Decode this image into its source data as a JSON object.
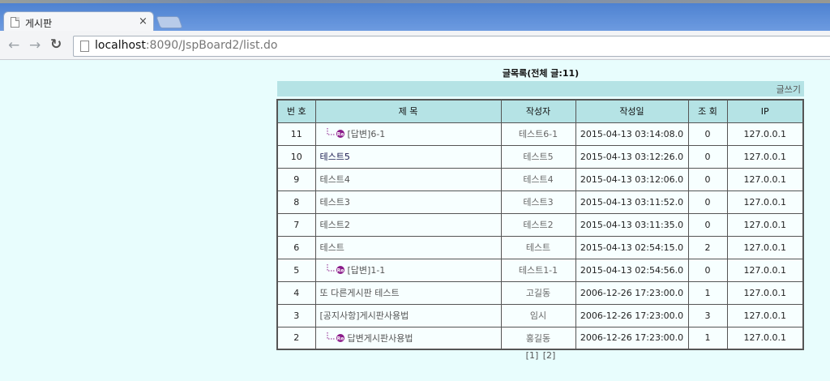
{
  "browser": {
    "tab_title": "게시판",
    "tab_close": "×",
    "url_host": "localhost",
    "url_rest": ":8090/JspBoard2/list.do"
  },
  "board": {
    "title": "글목록(전체 글:11)",
    "write_link": "글쓰기",
    "columns": [
      "번 호",
      "제 목",
      "작성자",
      "작성일",
      "조 회",
      "IP"
    ],
    "rows": [
      {
        "num": "11",
        "subject": "[답변]6-1",
        "writer": "테스트6-1",
        "date": "2015-04-13 03:14:08.0",
        "views": "0",
        "ip": "127.0.0.1",
        "reply": true
      },
      {
        "num": "10",
        "subject": "테스트5",
        "writer": "테스트5",
        "date": "2015-04-13 03:12:26.0",
        "views": "0",
        "ip": "127.0.0.1",
        "reply": false
      },
      {
        "num": "9",
        "subject": "테스트4",
        "writer": "테스트4",
        "date": "2015-04-13 03:12:06.0",
        "views": "0",
        "ip": "127.0.0.1",
        "reply": false
      },
      {
        "num": "8",
        "subject": "테스트3",
        "writer": "테스트3",
        "date": "2015-04-13 03:11:52.0",
        "views": "0",
        "ip": "127.0.0.1",
        "reply": false
      },
      {
        "num": "7",
        "subject": "테스트2",
        "writer": "테스트2",
        "date": "2015-04-13 03:11:35.0",
        "views": "0",
        "ip": "127.0.0.1",
        "reply": false
      },
      {
        "num": "6",
        "subject": "테스트",
        "writer": "테스트",
        "date": "2015-04-13 02:54:15.0",
        "views": "2",
        "ip": "127.0.0.1",
        "reply": false
      },
      {
        "num": "5",
        "subject": "[답변]1-1",
        "writer": "테스트1-1",
        "date": "2015-04-13 02:54:56.0",
        "views": "0",
        "ip": "127.0.0.1",
        "reply": true
      },
      {
        "num": "4",
        "subject": "또 다른게시판 테스트",
        "writer": "고길동",
        "date": "2006-12-26 17:23:00.0",
        "views": "1",
        "ip": "127.0.0.1",
        "reply": false
      },
      {
        "num": "3",
        "subject": "[공지사항]게시판사용법",
        "writer": "임시",
        "date": "2006-12-26 17:23:00.0",
        "views": "3",
        "ip": "127.0.0.1",
        "reply": false
      },
      {
        "num": "2",
        "subject": "답변게시판사용법",
        "writer": "홍길동",
        "date": "2006-12-26 17:23:00.0",
        "views": "1",
        "ip": "127.0.0.1",
        "reply": true
      }
    ],
    "pages": [
      "[1]",
      "[2]"
    ],
    "reply_icon": "re-icon",
    "colors": {
      "header_bg": "#b5e3e5",
      "page_bg": "#e8fdfd",
      "reply_badge": "#8a1b8a"
    }
  }
}
